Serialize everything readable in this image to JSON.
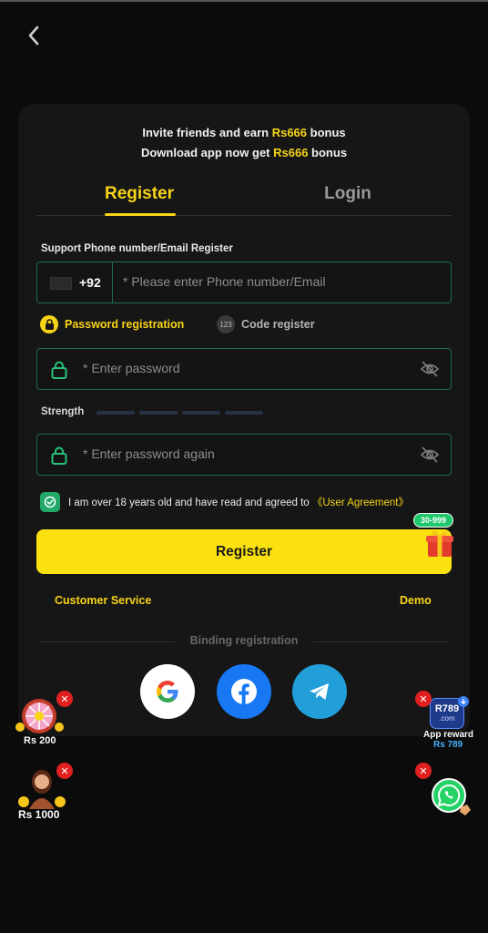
{
  "promo": {
    "line1_pre": "Invite friends and earn ",
    "line1_amount": "Rs666",
    "line1_post": " bonus",
    "line2_pre": "Download app now get ",
    "line2_amount": "Rs666",
    "line2_post": " bonus"
  },
  "tabs": {
    "register": "Register",
    "login": "Login"
  },
  "phone": {
    "label": "Support Phone number/Email Register",
    "country_code": "+92",
    "placeholder": "* Please enter Phone number/Email"
  },
  "modes": {
    "password": "Password registration",
    "code": "Code register",
    "code_icon_text": "123"
  },
  "password": {
    "placeholder": "* Enter password",
    "confirm_placeholder": "* Enter password again"
  },
  "strength": {
    "label": "Strength"
  },
  "agreement": {
    "text": "I am over 18 years old and have read and agreed to ",
    "link": "《User Agreement》"
  },
  "register_button": {
    "label": "Register",
    "badge": "30-999"
  },
  "links": {
    "customer_service": "Customer Service",
    "demo": "Demo"
  },
  "binding": {
    "label": "Binding registration",
    "providers": [
      "google-icon",
      "facebook-icon",
      "telegram-icon"
    ]
  },
  "floating": {
    "wheel_reward": "Rs 200",
    "lady_reward": "Rs 1000",
    "app_logo": "R789",
    "app_logo_sub": ".com",
    "app_reward_label": "App reward",
    "app_reward_amount": "Rs 789",
    "close_glyph": "✕"
  },
  "colors": {
    "accent": "#f7d417",
    "button": "#fbe10f",
    "field_border": "#1f6b4a",
    "check": "#21a96a",
    "background": "#0b0b0b",
    "card": "#161616"
  }
}
